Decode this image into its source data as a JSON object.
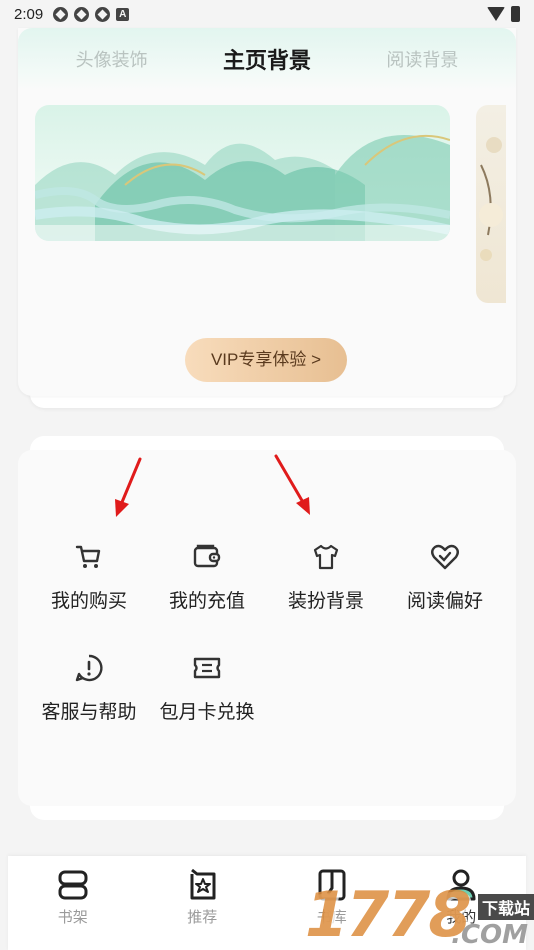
{
  "status_bar": {
    "time": "2:09"
  },
  "background_card": {
    "tabs": [
      {
        "label": "头像装饰",
        "active": false
      },
      {
        "label": "主页背景",
        "active": true
      },
      {
        "label": "阅读背景",
        "active": false
      }
    ],
    "vip_button": "VIP专享体验 >"
  },
  "menu": {
    "items": [
      {
        "label": "我的购买",
        "icon": "cart-icon"
      },
      {
        "label": "我的充值",
        "icon": "wallet-icon"
      },
      {
        "label": "装扮背景",
        "icon": "tshirt-icon"
      },
      {
        "label": "阅读偏好",
        "icon": "heart-check-icon"
      },
      {
        "label": "客服与帮助",
        "icon": "exclamation-circle-icon"
      },
      {
        "label": "包月卡兑换",
        "icon": "ticket-icon"
      }
    ]
  },
  "bottom_nav": {
    "items": [
      {
        "label": "书架",
        "icon": "bookshelf-icon",
        "active": false
      },
      {
        "label": "推荐",
        "icon": "star-doc-icon",
        "active": false
      },
      {
        "label": "书库",
        "icon": "book-icon",
        "active": false
      },
      {
        "label": "我的",
        "icon": "user-icon",
        "active": true
      }
    ]
  },
  "watermark": {
    "number": "1778",
    "tag": "下载站",
    "domain": ".COM"
  },
  "colors": {
    "accent_red": "#e01b1b",
    "vip_gradient_start": "#f8dcbc",
    "vip_gradient_end": "#e7bf92"
  }
}
